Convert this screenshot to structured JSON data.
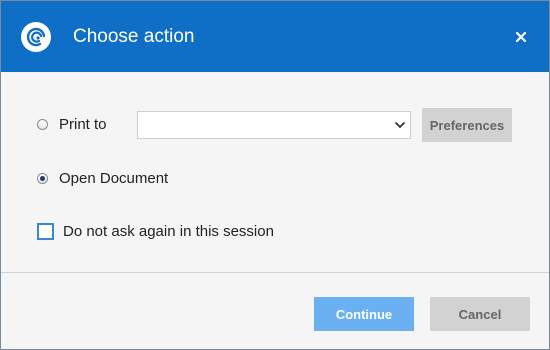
{
  "dialog": {
    "title": "Choose action",
    "close_glyph": "×",
    "logo_icon": "app-logo-icon",
    "colors": {
      "titlebar": "#0f6fc6",
      "primary_button": "#6bb1f2",
      "secondary_button": "#d2d2d2"
    }
  },
  "options": {
    "print_to": {
      "label": "Print to",
      "selected": false
    },
    "printer_select": {
      "value": ""
    },
    "preferences_label": "Preferences",
    "open_document": {
      "label": "Open Document",
      "selected": true
    },
    "dont_ask": {
      "label": "Do not ask again in this session",
      "checked": false
    }
  },
  "footer": {
    "continue_label": "Continue",
    "cancel_label": "Cancel"
  }
}
